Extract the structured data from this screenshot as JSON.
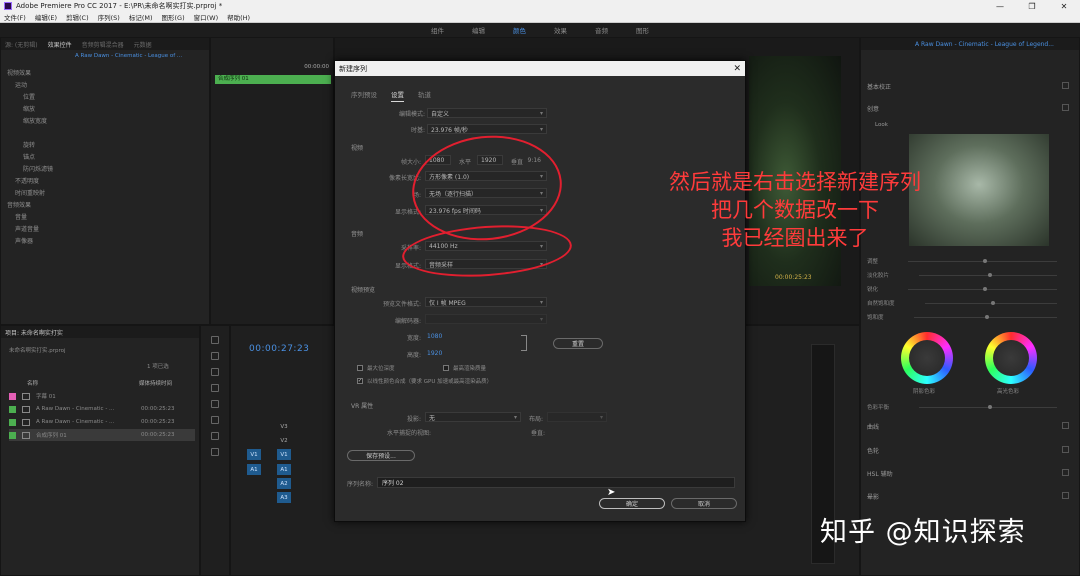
{
  "window": {
    "title": "Adobe Premiere Pro CC 2017 - E:\\PR\\未命名啊实打实.prproj *",
    "controls": [
      "—",
      "❐",
      "✕"
    ]
  },
  "menu": [
    "文件(F)",
    "编辑(E)",
    "剪辑(C)",
    "序列(S)",
    "标记(M)",
    "图形(G)",
    "窗口(W)",
    "帮助(H)"
  ],
  "workspaces": {
    "items": [
      "组件",
      "编辑",
      "颜色",
      "效果",
      "音频",
      "图形"
    ],
    "active_index": 2
  },
  "effect_controls": {
    "tabs": [
      "源: (无剪辑)",
      "效果控件",
      "音频剪辑混合器",
      "元数据"
    ],
    "active_tab": 1,
    "sequence_label": "A Raw Dawn - Cinematic - League of ...",
    "rows": [
      "视频效果",
      "运动",
      "位置",
      "缩放",
      "缩放宽度",
      "",
      "旋转",
      "锚点",
      "防闪烁滤镜",
      "不透明度",
      "时间重映射",
      "音频效果",
      "音量",
      "声道音量",
      "声像器"
    ]
  },
  "mini_timeline": {
    "timecode": "00:00:00",
    "clip_label": "合成序列 01"
  },
  "program_monitor": {
    "timecode": "00:00:25:23"
  },
  "lumetri": {
    "header": "A Raw Dawn - Cinematic - League of Legend...",
    "sections": [
      "基本校正",
      "创意",
      "曲线",
      "色轮",
      "HSL 辅助",
      "晕影"
    ],
    "look_label": "Look",
    "sliders": [
      "调整",
      "淡化胶片",
      "锐化",
      "自然饱和度",
      "饱和度"
    ],
    "wheel_labels": [
      "阴影色彩",
      "高光色彩"
    ],
    "balance_label": "色彩平衡"
  },
  "project": {
    "tab": "项目: 未命名啊实打实",
    "file": "未命名啊实打实.prproj",
    "count": "1 项已选",
    "columns": [
      "名称",
      "媒体持续时间"
    ],
    "items": [
      {
        "name": "字幕 01",
        "duration": "",
        "color": "#e45fb5"
      },
      {
        "name": "A Raw Dawn - Cinematic - ...",
        "duration": "00:00:25:23",
        "color": "#4caf50"
      },
      {
        "name": "A Raw Dawn - Cinematic - ...",
        "duration": "00:00:25:23",
        "color": "#4caf50"
      },
      {
        "name": "合成序列 01",
        "duration": "00:00:25:23",
        "color": "#4caf50"
      }
    ]
  },
  "timeline": {
    "timecode": "00:00:27:23",
    "tracks_video": [
      "V3",
      "V2",
      "V1"
    ],
    "tracks_audio": [
      "A1",
      "A2",
      "A3"
    ],
    "source_left": [
      "V1",
      "A1"
    ]
  },
  "dialog": {
    "title": "新建序列",
    "close": "✕",
    "tabs": [
      "序列预设",
      "设置",
      "轨道"
    ],
    "active_tab": 1,
    "editing_mode_label": "编辑模式:",
    "editing_mode": "自定义",
    "timebase_label": "时基:",
    "timebase": "23.976 帧/秒",
    "video_section": "视频",
    "frame_size_label": "帧大小:",
    "frame_width": "1080",
    "frame_h_label": "水平",
    "frame_height": "1920",
    "frame_v_label": "垂直",
    "aspect": "9:16",
    "pixel_aspect_label": "像素长宽比:",
    "pixel_aspect": "方形像素 (1.0)",
    "field_label": "场:",
    "field": "无场（逐行扫描）",
    "display_format_label": "显示格式:",
    "display_format": "23.976 fps 时间码",
    "audio_section": "音频",
    "sample_rate_label": "采样率:",
    "sample_rate": "44100 Hz",
    "audio_display_label": "显示格式:",
    "audio_display": "音频采样",
    "preview_section": "视频预览",
    "preview_format_label": "预览文件格式:",
    "preview_format": "仅 I 帧 MPEG",
    "codec_label": "编解码器:",
    "width_label": "宽度:",
    "width_val": "1080",
    "height_label": "高度:",
    "height_val": "1920",
    "reset_btn": "重置",
    "chk_max_depth": "最大位深度",
    "chk_max_quality": "最高渲染质量",
    "chk_linear": "以线性颜色合成（要求 GPU 加速或最高渲染品质）",
    "vr_section": "VR 属性",
    "projection_label": "投影:",
    "projection": "无",
    "layout_label": "布局:",
    "h_view_label": "水平捕捉的视图:",
    "v_label": "垂直:",
    "save_preset_btn": "保存预设...",
    "seq_name_label": "序列名称:",
    "seq_name": "序列 02",
    "ok_btn": "确定",
    "cancel_btn": "取消"
  },
  "annotation": {
    "lines": [
      "然后就是右击选择新建序列",
      "把几个数据改一下",
      "我已经圈出来了"
    ],
    "color": "#ff3b3b"
  },
  "watermark": "知乎 @知识探索"
}
